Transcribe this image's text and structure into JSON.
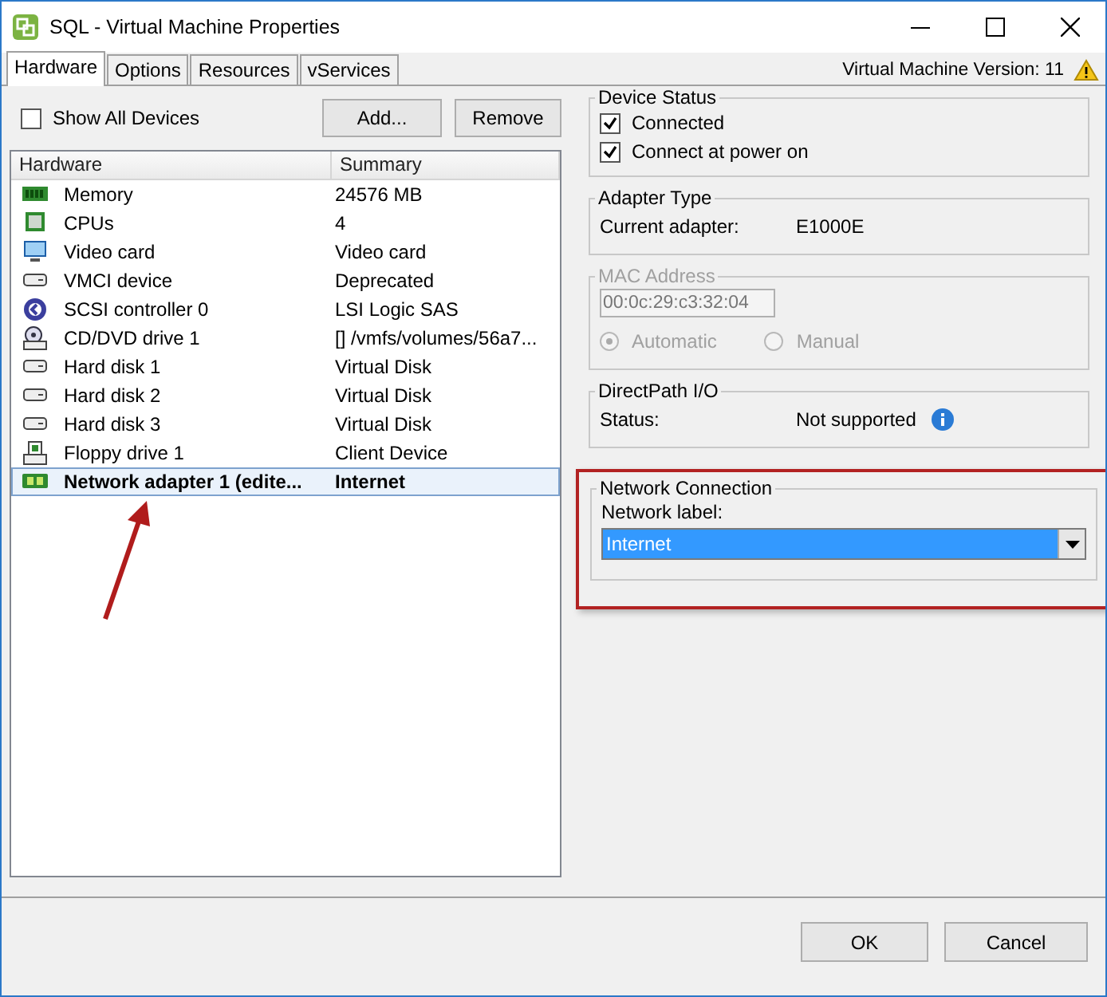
{
  "window": {
    "title": "SQL - Virtual Machine Properties"
  },
  "tabs": [
    {
      "label": "Hardware",
      "selected": true
    },
    {
      "label": "Options",
      "selected": false
    },
    {
      "label": "Resources",
      "selected": false
    },
    {
      "label": "vServices",
      "selected": false
    }
  ],
  "version_label": "Virtual Machine Version: 11",
  "show_all_devices": {
    "label": "Show All Devices",
    "checked": false
  },
  "toolbar_buttons": [
    "Add...",
    "Remove"
  ],
  "table": {
    "columns": [
      "Hardware",
      "Summary"
    ],
    "rows": [
      {
        "kind": "memory",
        "name": "Memory",
        "summary": "24576 MB",
        "selected": false
      },
      {
        "kind": "cpu",
        "name": "CPUs",
        "summary": "4",
        "selected": false
      },
      {
        "kind": "video",
        "name": "Video card",
        "summary": "Video card",
        "selected": false
      },
      {
        "kind": "disk",
        "name": "VMCI device",
        "summary": "Deprecated",
        "selected": false
      },
      {
        "kind": "scsi",
        "name": "SCSI controller 0",
        "summary": "LSI Logic SAS",
        "selected": false
      },
      {
        "kind": "cdrom",
        "name": "CD/DVD drive 1",
        "summary": "[] /vmfs/volumes/56a7...",
        "selected": false
      },
      {
        "kind": "disk",
        "name": "Hard disk 1",
        "summary": "Virtual Disk",
        "selected": false
      },
      {
        "kind": "disk",
        "name": "Hard disk 2",
        "summary": "Virtual Disk",
        "selected": false
      },
      {
        "kind": "disk",
        "name": "Hard disk 3",
        "summary": "Virtual Disk",
        "selected": false
      },
      {
        "kind": "floppy",
        "name": "Floppy drive 1",
        "summary": "Client Device",
        "selected": false
      },
      {
        "kind": "network",
        "name": "Network adapter 1 (edite...",
        "summary": "Internet",
        "selected": true
      }
    ]
  },
  "device_status": {
    "title": "Device Status",
    "options": [
      {
        "label": "Connected",
        "checked": true
      },
      {
        "label": "Connect at power on",
        "checked": true
      }
    ]
  },
  "adapter_type": {
    "title": "Adapter Type",
    "label": "Current adapter:",
    "value": "E1000E"
  },
  "mac_address": {
    "title": "MAC Address",
    "disabled": true,
    "value": "00:0c:29:c3:32:04",
    "options": [
      {
        "label": "Automatic",
        "selected": true
      },
      {
        "label": "Manual",
        "selected": false
      }
    ]
  },
  "directpath": {
    "title": "DirectPath I/O",
    "label": "Status:",
    "value": "Not supported"
  },
  "network_connection": {
    "title": "Network Connection",
    "label": "Network label:",
    "value": "Internet",
    "highlighted": true
  },
  "dialog_buttons": [
    "OK",
    "Cancel"
  ]
}
